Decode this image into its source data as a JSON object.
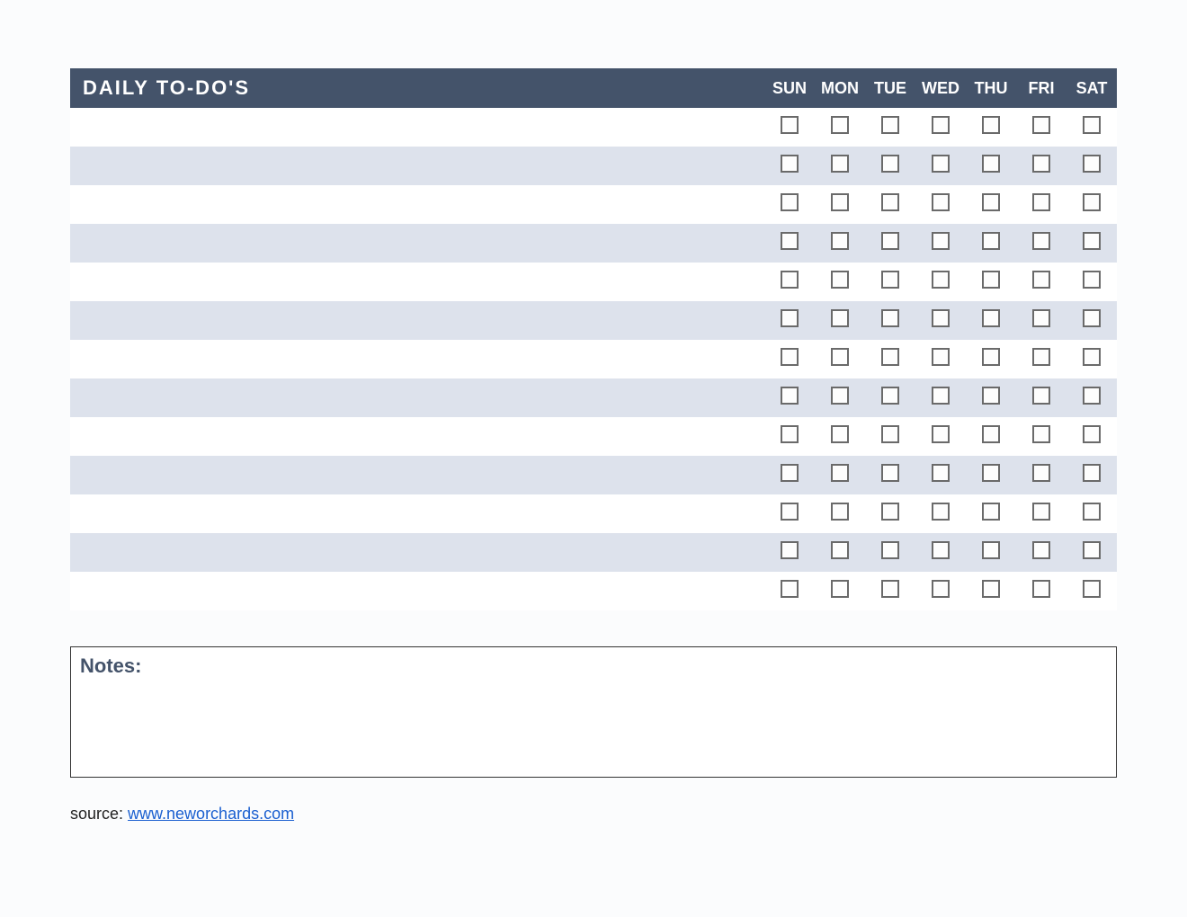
{
  "header": {
    "title": "DAILY TO-DO'S",
    "days": [
      "SUN",
      "MON",
      "TUE",
      "WED",
      "THU",
      "FRI",
      "SAT"
    ]
  },
  "tasks": [
    {
      "label": ""
    },
    {
      "label": ""
    },
    {
      "label": ""
    },
    {
      "label": ""
    },
    {
      "label": ""
    },
    {
      "label": ""
    },
    {
      "label": ""
    },
    {
      "label": ""
    },
    {
      "label": ""
    },
    {
      "label": ""
    },
    {
      "label": ""
    },
    {
      "label": ""
    },
    {
      "label": ""
    }
  ],
  "notes": {
    "label": "Notes:",
    "content": ""
  },
  "source": {
    "prefix": "source: ",
    "link_text": "www.neworchards.com"
  }
}
